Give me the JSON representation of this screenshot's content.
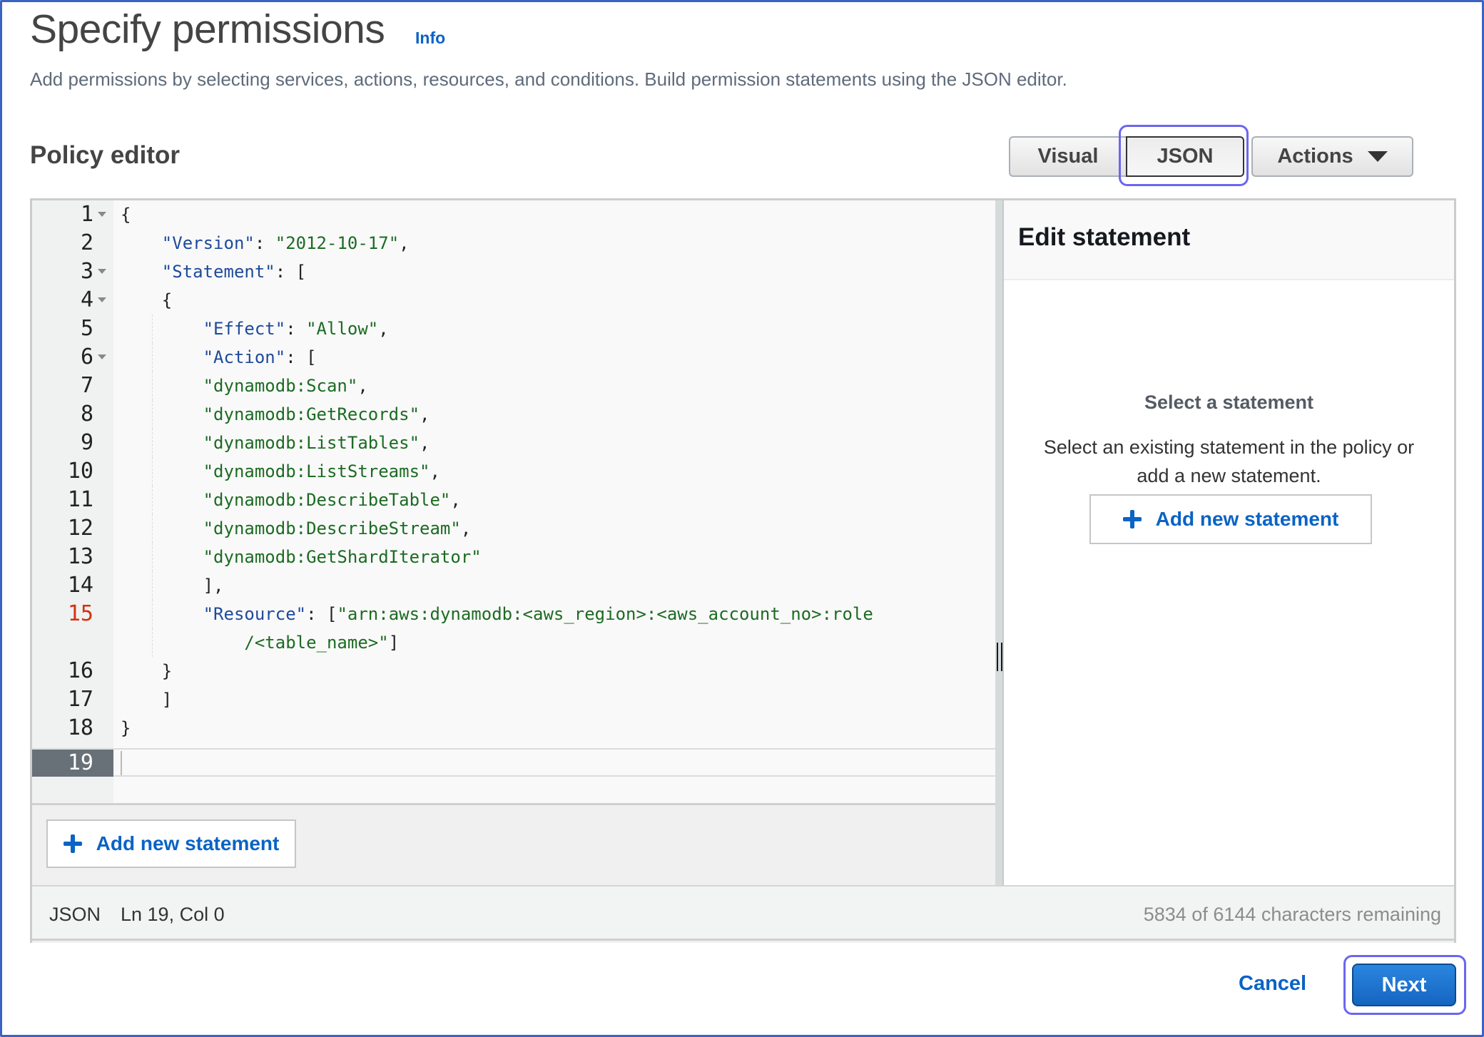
{
  "header": {
    "title": "Specify permissions",
    "info_link": "Info",
    "subtitle": "Add permissions by selecting services, actions, resources, and conditions. Build permission statements using the JSON editor."
  },
  "policy_editor": {
    "title": "Policy editor",
    "mode_toggle": {
      "visual": "Visual",
      "json": "JSON",
      "selected": "JSON"
    },
    "actions_button": "Actions",
    "code_lines": [
      {
        "n": "1",
        "text": "{"
      },
      {
        "n": "2",
        "text": "    \"Version\": \"2012-10-17\","
      },
      {
        "n": "3",
        "text": "    \"Statement\": ["
      },
      {
        "n": "4",
        "text": "    {"
      },
      {
        "n": "5",
        "text": "        \"Effect\": \"Allow\","
      },
      {
        "n": "6",
        "text": "        \"Action\": ["
      },
      {
        "n": "7",
        "text": "        \"dynamodb:Scan\","
      },
      {
        "n": "8",
        "text": "        \"dynamodb:GetRecords\","
      },
      {
        "n": "9",
        "text": "        \"dynamodb:ListTables\","
      },
      {
        "n": "10",
        "text": "        \"dynamodb:ListStreams\","
      },
      {
        "n": "11",
        "text": "        \"dynamodb:DescribeTable\","
      },
      {
        "n": "12",
        "text": "        \"dynamodb:DescribeStream\","
      },
      {
        "n": "13",
        "text": "        \"dynamodb:GetShardIterator\""
      },
      {
        "n": "14",
        "text": "        ],"
      },
      {
        "n": "15",
        "text": "        \"Resource\": [\"arn:aws:dynamodb:<aws_region>:<aws_account_no>:role"
      },
      {
        "n": "",
        "text": "            /<table_name>\"]"
      },
      {
        "n": "16",
        "text": "    }"
      },
      {
        "n": "17",
        "text": "    ]"
      },
      {
        "n": "18",
        "text": "}"
      }
    ],
    "active_line_number": "19",
    "error_line": "15",
    "add_statement_button": "Add new statement"
  },
  "edit_statement_panel": {
    "title": "Edit statement",
    "empty_title": "Select a statement",
    "empty_text_line1": "Select an existing statement in the policy or",
    "empty_text_line2": "add a new statement.",
    "add_statement_button": "Add new statement"
  },
  "status_bar": {
    "mode": "JSON",
    "position": "Ln 19, Col 0",
    "characters_remaining": "5834 of 6144 characters remaining"
  },
  "footer": {
    "cancel": "Cancel",
    "next": "Next"
  },
  "colors": {
    "link_blue": "#0a63c5",
    "primary_button": "#1b72d1",
    "focus_ring": "#6b66f0",
    "json_key": "#1e4a9b",
    "json_string": "#1c6b22",
    "error_line_number": "#d13212"
  }
}
